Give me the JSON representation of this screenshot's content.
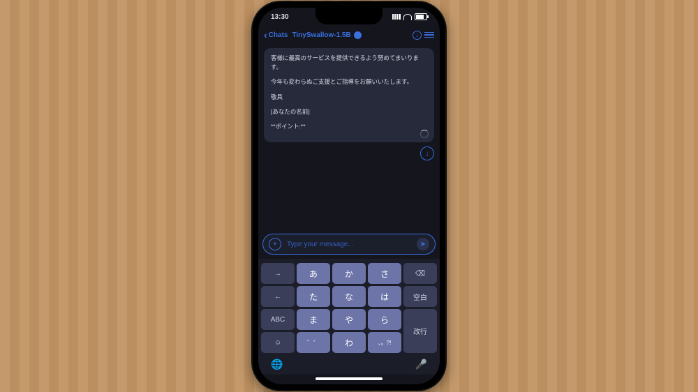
{
  "status": {
    "time": "13:30"
  },
  "nav": {
    "back_label": "Chats",
    "title": "TinySwallow-1.5B"
  },
  "chat": {
    "bubble": {
      "l1": "客様に最高のサービスを提供できるよう努めてまいります。",
      "l2": "今年も変わらぬご支援とご指導をお願いいたします。",
      "l3": "敬具",
      "l4": "[あなたの名前]",
      "l5": "**ポイント:**"
    }
  },
  "input": {
    "placeholder": "Type your message..."
  },
  "keyboard": {
    "rows": [
      {
        "fnL": "→",
        "k": [
          "あ",
          "か",
          "さ"
        ],
        "fnR": "⌫"
      },
      {
        "fnL": "←",
        "k": [
          "た",
          "な",
          "は"
        ],
        "fnR": "空白"
      },
      {
        "fnL": "ABC",
        "k": [
          "ま",
          "や",
          "ら"
        ],
        "fnR": "改行"
      },
      {
        "fnL": "☺",
        "k": [
          "゛゜",
          "わ",
          "、。?!"
        ],
        "fnR": ""
      }
    ],
    "globe": "🌐",
    "mic": "🎤"
  }
}
